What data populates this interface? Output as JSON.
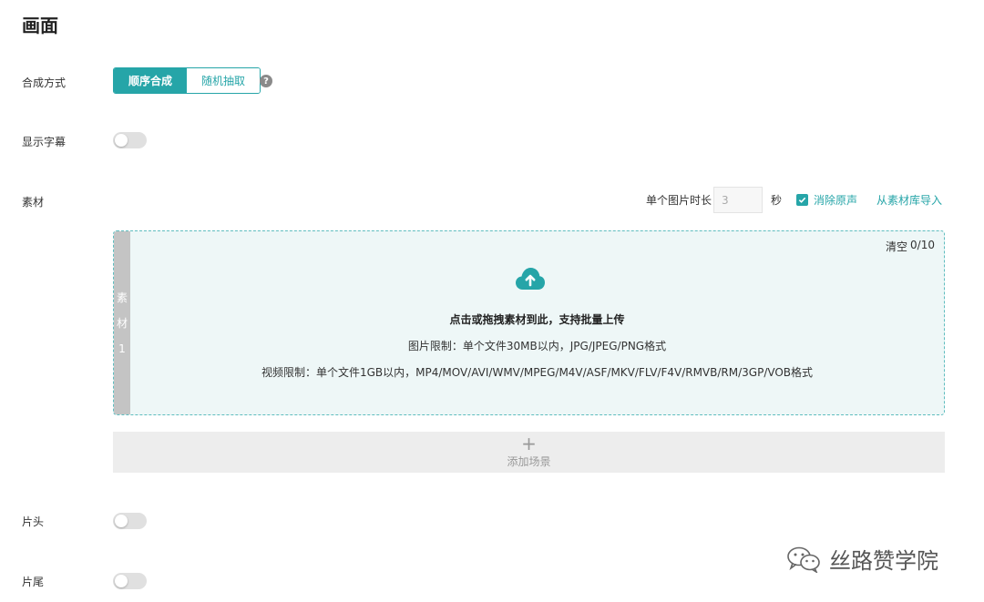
{
  "section": {
    "title": "画面"
  },
  "compose": {
    "label": "合成方式",
    "options": [
      "顺序合成",
      "随机抽取"
    ],
    "selected": "顺序合成",
    "help_icon": "question-circle-icon"
  },
  "subtitles": {
    "label": "显示字幕",
    "enabled": false
  },
  "material": {
    "label": "素材",
    "duration_label": "单个图片时长",
    "duration_value": "3",
    "duration_unit": "秒",
    "mute_label": "消除原声",
    "mute_checked": true,
    "import_link": "从素材库导入",
    "upload": {
      "tab_label": "素材1",
      "tab_chars": [
        "素",
        "材",
        "1"
      ],
      "clear_label": "清空",
      "count": "0/10",
      "icon": "cloud-upload-icon",
      "main_text": "点击或拖拽素材到此，支持批量上传",
      "image_limit": "图片限制：单个文件30MB以内，JPG/JPEG/PNG格式",
      "video_limit": "视频限制：单个文件1GB以内，MP4/MOV/AVI/WMV/MPEG/M4V/ASF/MKV/FLV/F4V/RMVB/RM/3GP/VOB格式"
    },
    "add_scene": {
      "icon": "plus-icon",
      "label": "添加场景"
    }
  },
  "intro": {
    "label": "片头",
    "enabled": false
  },
  "outro": {
    "label": "片尾",
    "enabled": false
  },
  "watermark": {
    "icon": "wechat-icon",
    "text": "丝路赞学院"
  },
  "colors": {
    "accent": "#26a5a8",
    "toggle_off": "#e0e0e0",
    "upload_bg": "#eef7f7"
  }
}
